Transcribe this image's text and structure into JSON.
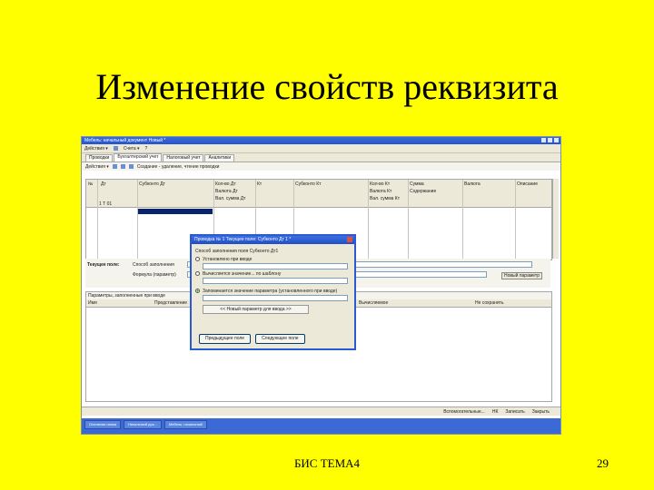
{
  "slide": {
    "title": "Изменение свойств реквизита",
    "footer_center": "БИС ТЕМА4",
    "page_number": "29"
  },
  "app": {
    "window_title": "Мебель: начальный документ Новый *",
    "toolbar": [
      "Действия ▾",
      "Счета ▾",
      "?"
    ],
    "tabs": [
      "Проводки",
      "Бухгалтерский учет",
      "Налоговый учет",
      "Аналитики"
    ],
    "subbar_label": "Действия ▾",
    "subbar_text": "Создание - удаление, чтение проводки",
    "grid_headers": [
      "№",
      "Дт",
      "Субконто Дт",
      "Кол-во Дт",
      "Кт",
      "Субконто Кт",
      "Кол-во Кт",
      "Сумма",
      "Валюта",
      "Описание"
    ],
    "grid_headers2": [
      "Валюта Дт",
      "Вал. сумма Дт",
      "Валюта Кт",
      "Вал. сумма Кт",
      "Содержание"
    ],
    "grid_row1": "1  Т  01",
    "strip_label": "Текущее поле:",
    "strip_text1": "Способ заполнения",
    "strip_text2": "Формула (параметр)",
    "strip_button": "Новый параметр",
    "lower_title": "Параметры, заполненные при вводе",
    "lower_headers": [
      "Имя",
      "Представление",
      "Вычисляемое",
      "Не сохранять"
    ],
    "statusbar": [
      "Вспомогательные...",
      "НК",
      "Записать",
      "Закрыть"
    ],
    "taskbar": [
      "Основная папка",
      "Начальный док...",
      "Мебель: начальный"
    ]
  },
  "dialog": {
    "title": "Проводка № 1   Текущее поле: Субконто Дт 1 *",
    "section": "Способ заполнения поля  Субконто Дт1",
    "option1": "Установлено при вводе",
    "option2": "Вычисляется значение... по шаблону",
    "option3": "Запоминается значение параметра (установленного при вводе)",
    "placeholder": "<< Новый параметр для ввода >>",
    "btn_prev": "Предыдущее поле",
    "btn_next": "Следующее поле"
  }
}
